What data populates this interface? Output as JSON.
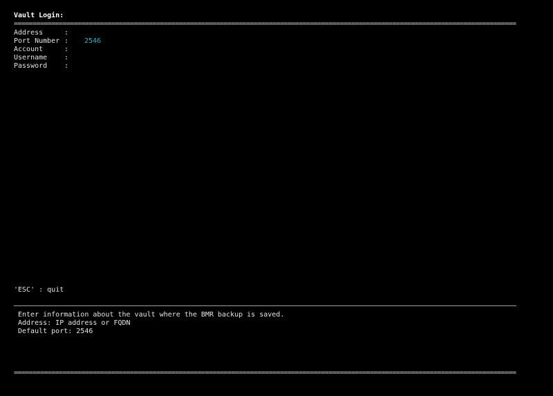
{
  "title": "Vault Login:",
  "rule_double": "==========================================================================================================================================",
  "fields": [
    {
      "label": "Address",
      "value": ""
    },
    {
      "label": "Port Number",
      "value": "2546"
    },
    {
      "label": "Account",
      "value": ""
    },
    {
      "label": "Username",
      "value": ""
    },
    {
      "label": "Password",
      "value": ""
    }
  ],
  "colon": ":",
  "shortcut": "'ESC' : quit",
  "help": {
    "line1": "Enter information about the vault where the BMR backup is saved.",
    "line2": "Address: IP address or FQDN",
    "line3": "Default port: 2546"
  },
  "colors": {
    "background": "#000000",
    "text": "#e6e6e6",
    "value_accent": "#2fb4c8"
  }
}
